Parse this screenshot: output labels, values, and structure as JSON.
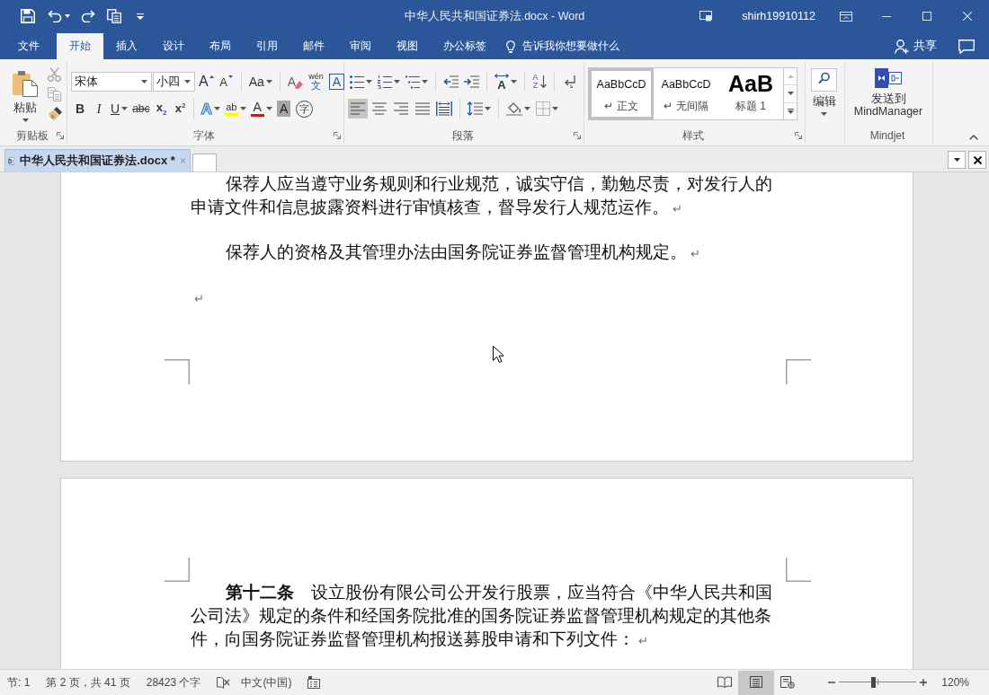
{
  "window": {
    "title": "中华人民共和国证券法.docx - Word",
    "user": "shirh19910112"
  },
  "ribbon_tabs": [
    {
      "label": "文件",
      "selected": false
    },
    {
      "label": "开始",
      "selected": true
    },
    {
      "label": "插入",
      "selected": false
    },
    {
      "label": "设计",
      "selected": false
    },
    {
      "label": "布局",
      "selected": false
    },
    {
      "label": "引用",
      "selected": false
    },
    {
      "label": "邮件",
      "selected": false
    },
    {
      "label": "审阅",
      "selected": false
    },
    {
      "label": "视图",
      "selected": false
    },
    {
      "label": "办公标签",
      "selected": false
    }
  ],
  "tell_me": {
    "placeholder": "告诉我你想要做什么"
  },
  "share": {
    "label": "共享"
  },
  "ribbon": {
    "clipboard": {
      "label": "剪贴板",
      "paste": "粘贴",
      "tools": [
        {
          "kind": "cut",
          "disabled": true
        },
        {
          "kind": "copy",
          "disabled": true
        },
        {
          "kind": "format_painter",
          "disabled": false
        }
      ]
    },
    "font": {
      "label": "字体",
      "font_name": "宋体",
      "font_size": "小四",
      "row1": [
        {
          "kind": "grow",
          "glyph": "A"
        },
        {
          "kind": "shrink",
          "glyph": "A"
        },
        {
          "kind": "change_case",
          "glyph": "Aa"
        },
        {
          "kind": "clear_format",
          "glyph": "A"
        },
        {
          "kind": "phonetic",
          "glyph": "wén",
          "glyph2": "文"
        },
        {
          "kind": "char_border",
          "glyph": "A"
        }
      ],
      "row2": [
        {
          "kind": "bold",
          "glyph": "B"
        },
        {
          "kind": "italic",
          "glyph": "I"
        },
        {
          "kind": "underline",
          "glyph": "U"
        },
        {
          "kind": "strike",
          "glyph": "abc"
        },
        {
          "kind": "subscript",
          "glyph": "x$_{2}$"
        },
        {
          "kind": "superscript",
          "glyph": "x$^{2}$"
        },
        {
          "kind": "text_effects",
          "glyph": "A"
        },
        {
          "kind": "highlight",
          "glyph": "ab",
          "color": "#ffff00"
        },
        {
          "kind": "font_color",
          "glyph": "A",
          "color": "#ff0000"
        },
        {
          "kind": "shading",
          "glyph": "A"
        },
        {
          "kind": "enclose",
          "glyph": "字"
        }
      ]
    },
    "paragraph": {
      "label": "段落",
      "row1": [
        {
          "kind": "bullets"
        },
        {
          "kind": "numbering"
        },
        {
          "kind": "multilevel"
        },
        {
          "kind": "decrease_indent"
        },
        {
          "kind": "increase_indent"
        },
        {
          "kind": "asian_layout",
          "glyph": "A"
        },
        {
          "kind": "sort",
          "glyph": "A",
          "glyph2": "Z"
        },
        {
          "kind": "show_marks"
        }
      ],
      "alignment": [
        {
          "kind": "left",
          "selected": true
        },
        {
          "kind": "center",
          "selected": false
        },
        {
          "kind": "right",
          "selected": false
        },
        {
          "kind": "justify",
          "selected": false
        },
        {
          "kind": "distribute",
          "selected": false
        }
      ],
      "row2": [
        {
          "kind": "line_spacing"
        },
        {
          "kind": "shading"
        },
        {
          "kind": "borders"
        }
      ]
    },
    "styles": {
      "label": "样式",
      "items": [
        {
          "kind": "normal",
          "preview": "AaBbCcD",
          "mark": "↵",
          "name": "正文",
          "selected": true
        },
        {
          "kind": "normal",
          "preview": "AaBbCcD",
          "mark": "↵",
          "name": "无间隔",
          "selected": false
        },
        {
          "kind": "heading",
          "preview": "AaB",
          "name": "标题 1",
          "selected": false
        }
      ]
    },
    "editing": {
      "label": "编辑"
    },
    "mindjet": {
      "label": "Mindjet",
      "button": "发送到 MindManager"
    }
  },
  "doc_tabs": [
    {
      "label": "中华人民共和国证券法.docx *",
      "selected": true
    }
  ],
  "pages": [
    {
      "paragraphs": [
        {
          "text": "保荐人应当遵守业务规则和行业规范，诚实守信，勤勉尽责，对发行人的申请文件和信息披露资料进行审慎核查，督导发行人规范运作。",
          "mark": "↵"
        },
        {
          "text": "保荐人的资格及其管理办法由国务院证券监督管理机构规定。",
          "mark": "↵"
        },
        {
          "mark": "↵"
        }
      ]
    },
    {
      "paragraphs": [
        {
          "text": "**第十二条**　设立股份有限公司公开发行股票，应当符合《中华人民共和国公司法》规定的条件和经国务院批准的国务院证券监督管理机构规定的其他条件，向国务院证券监督管理机构报送募股申请和下列文件：",
          "mark": "↵"
        }
      ]
    }
  ],
  "status_bar": {
    "section": "节: 1",
    "page": "第 2 页，共 41 页",
    "words": "28423 个字",
    "language": "中文(中国)",
    "views": [
      {
        "kind": "read",
        "selected": false
      },
      {
        "kind": "print",
        "selected": true
      },
      {
        "kind": "web",
        "selected": false
      }
    ],
    "zoom": {
      "level": 0.44,
      "reading": "120%"
    }
  }
}
